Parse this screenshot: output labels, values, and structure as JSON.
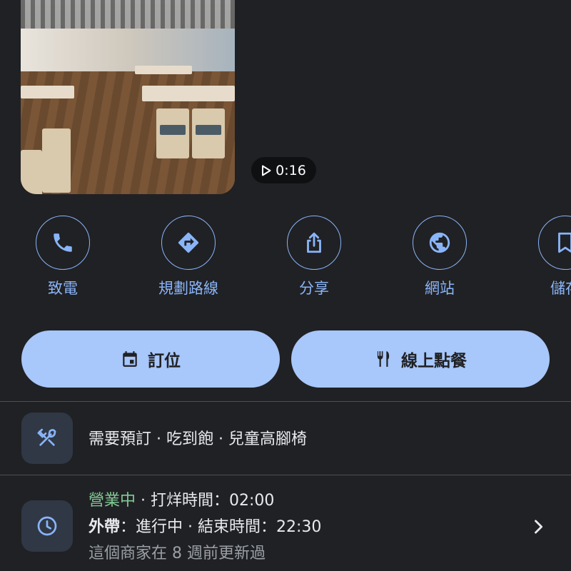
{
  "media": {
    "duration_label": "0:16"
  },
  "actions": [
    {
      "label": "致電",
      "icon": "phone-icon"
    },
    {
      "label": "規劃路線",
      "icon": "directions-icon"
    },
    {
      "label": "分享",
      "icon": "share-icon"
    },
    {
      "label": "網站",
      "icon": "globe-icon"
    },
    {
      "label": "儲存",
      "icon": "bookmark-icon"
    }
  ],
  "buttons": {
    "reserve_label": "訂位",
    "order_online_label": "線上點餐"
  },
  "amenities": {
    "text": "需要預訂 · 吃到飽 · 兒童高腳椅"
  },
  "hours": {
    "status": "營業中",
    "closing": " · 打烊時間：02:00",
    "takeout_label": "外帶",
    "takeout_detail": "：進行中 · 結束時間：22:30",
    "updated_note": "這個商家在 8 週前更新過"
  },
  "colors": {
    "background": "#202124",
    "accent": "#8ab4f8",
    "pill": "#a8c7fa",
    "open_green": "#81c995"
  }
}
